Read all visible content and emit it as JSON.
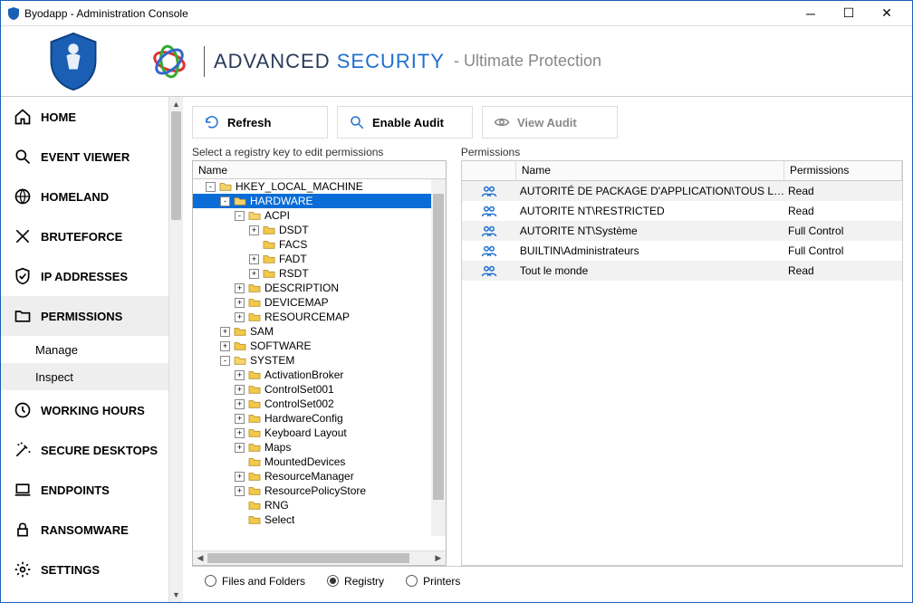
{
  "window": {
    "title": "Byodapp - Administration Console"
  },
  "brand": {
    "name": "ADVANCED ",
    "name2": "SECURITY",
    "tagline": "- Ultimate Protection"
  },
  "sidebar": {
    "items": [
      {
        "label": "HOME"
      },
      {
        "label": "EVENT VIEWER"
      },
      {
        "label": "HOMELAND"
      },
      {
        "label": "BRUTEFORCE"
      },
      {
        "label": "IP ADDRESSES"
      },
      {
        "label": "PERMISSIONS"
      },
      {
        "label": "WORKING HOURS"
      },
      {
        "label": "SECURE DESKTOPS"
      },
      {
        "label": "ENDPOINTS"
      },
      {
        "label": "RANSOMWARE"
      },
      {
        "label": "SETTINGS"
      }
    ],
    "sub_permissions": [
      {
        "label": "Manage"
      },
      {
        "label": "Inspect"
      }
    ]
  },
  "toolbar": {
    "refresh": "Refresh",
    "enable_audit": "Enable Audit",
    "view_audit": "View Audit"
  },
  "tree": {
    "title": "Select a registry key to edit permissions",
    "header": "Name",
    "nodes": [
      {
        "depth": 0,
        "exp": "-",
        "open": true,
        "label": "HKEY_LOCAL_MACHINE",
        "sel": false
      },
      {
        "depth": 1,
        "exp": "-",
        "open": true,
        "label": "HARDWARE",
        "sel": true
      },
      {
        "depth": 2,
        "exp": "-",
        "open": true,
        "label": "ACPI"
      },
      {
        "depth": 3,
        "exp": "+",
        "open": false,
        "label": "DSDT"
      },
      {
        "depth": 3,
        "exp": "",
        "open": false,
        "label": "FACS"
      },
      {
        "depth": 3,
        "exp": "+",
        "open": false,
        "label": "FADT"
      },
      {
        "depth": 3,
        "exp": "+",
        "open": false,
        "label": "RSDT"
      },
      {
        "depth": 2,
        "exp": "+",
        "open": false,
        "label": "DESCRIPTION"
      },
      {
        "depth": 2,
        "exp": "+",
        "open": false,
        "label": "DEVICEMAP"
      },
      {
        "depth": 2,
        "exp": "+",
        "open": false,
        "label": "RESOURCEMAP"
      },
      {
        "depth": 1,
        "exp": "+",
        "open": false,
        "label": "SAM"
      },
      {
        "depth": 1,
        "exp": "+",
        "open": false,
        "label": "SOFTWARE"
      },
      {
        "depth": 1,
        "exp": "-",
        "open": true,
        "label": "SYSTEM"
      },
      {
        "depth": 2,
        "exp": "+",
        "open": false,
        "label": "ActivationBroker"
      },
      {
        "depth": 2,
        "exp": "+",
        "open": false,
        "label": "ControlSet001"
      },
      {
        "depth": 2,
        "exp": "+",
        "open": false,
        "label": "ControlSet002"
      },
      {
        "depth": 2,
        "exp": "+",
        "open": false,
        "label": "HardwareConfig"
      },
      {
        "depth": 2,
        "exp": "+",
        "open": false,
        "label": "Keyboard Layout"
      },
      {
        "depth": 2,
        "exp": "+",
        "open": false,
        "label": "Maps"
      },
      {
        "depth": 2,
        "exp": "",
        "open": false,
        "label": "MountedDevices"
      },
      {
        "depth": 2,
        "exp": "+",
        "open": false,
        "label": "ResourceManager"
      },
      {
        "depth": 2,
        "exp": "+",
        "open": false,
        "label": "ResourcePolicyStore"
      },
      {
        "depth": 2,
        "exp": "",
        "open": false,
        "label": "RNG"
      },
      {
        "depth": 2,
        "exp": "",
        "open": false,
        "label": "Select"
      }
    ]
  },
  "permissions": {
    "title": "Permissions",
    "columns": {
      "c0": "",
      "c1": "Name",
      "c2": "Permissions"
    },
    "rows": [
      {
        "name": "AUTORITÉ DE PACKAGE D'APPLICATION\\TOUS L…",
        "perm": "Read"
      },
      {
        "name": "AUTORITE NT\\RESTRICTED",
        "perm": "Read"
      },
      {
        "name": "AUTORITE NT\\Système",
        "perm": "Full Control"
      },
      {
        "name": "BUILTIN\\Administrateurs",
        "perm": "Full Control"
      },
      {
        "name": "Tout le monde",
        "perm": "Read"
      }
    ]
  },
  "footer": {
    "options": [
      {
        "label": "Files and Folders",
        "checked": false
      },
      {
        "label": "Registry",
        "checked": true
      },
      {
        "label": "Printers",
        "checked": false
      }
    ]
  }
}
